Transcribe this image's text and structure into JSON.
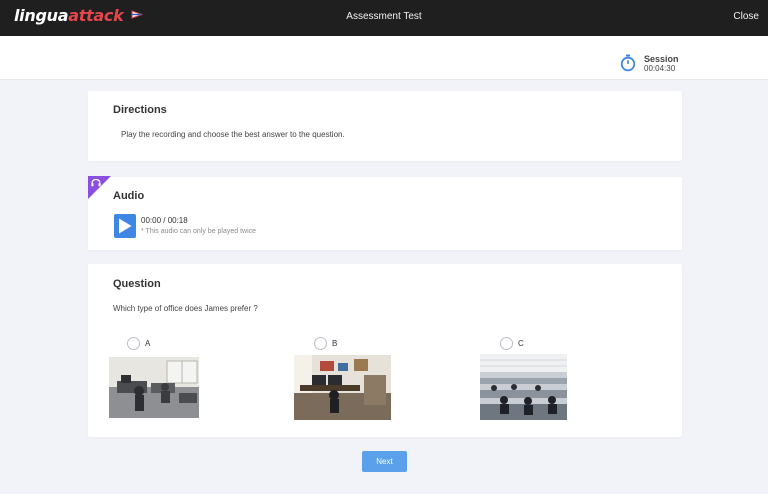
{
  "header": {
    "logo_part1": "lingua",
    "logo_part2": "attack",
    "title": "Assessment Test",
    "close_label": "Close",
    "logo_color": "#e4464c"
  },
  "session": {
    "label": "Session",
    "time": "00:04:30",
    "icon": "stopwatch-icon"
  },
  "directions": {
    "title": "Directions",
    "text": "Play the recording and choose the best answer to the question."
  },
  "audio": {
    "title": "Audio",
    "time": "00:00 / 00:18",
    "note": "This audio can only be played twice",
    "play_icon": "play-icon",
    "corner_icon": "headphones-icon",
    "accent": "#8a4fe0"
  },
  "question": {
    "title": "Question",
    "text": "Which type of office does James prefer ?",
    "options": [
      {
        "label": "A",
        "image": "small-office-photo"
      },
      {
        "label": "B",
        "image": "home-office-photo"
      },
      {
        "label": "C",
        "image": "open-plan-office-photo"
      }
    ]
  },
  "next_label": "Next",
  "colors": {
    "primary": "#3e86e4",
    "next_button": "#5aa0ea",
    "topbar": "#1f1f1f"
  }
}
